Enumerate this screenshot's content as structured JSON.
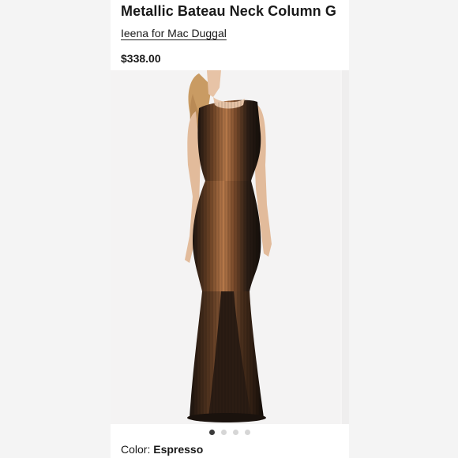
{
  "product": {
    "title": "Metallic Bateau Neck Column G",
    "brand": "Ieena for Mac Duggal",
    "price": "$338.00"
  },
  "gallery": {
    "image_subject": "model-in-metallic-gown",
    "dots": [
      {
        "active": true
      },
      {
        "active": false
      },
      {
        "active": false
      },
      {
        "active": false
      }
    ]
  },
  "color": {
    "label": "Color: ",
    "value": "Espresso"
  },
  "colors": {
    "gown_base": "#2a1d15",
    "gown_sheen": "#b7794a",
    "hair": "#c99b63",
    "skin": "#e7c3a6"
  }
}
